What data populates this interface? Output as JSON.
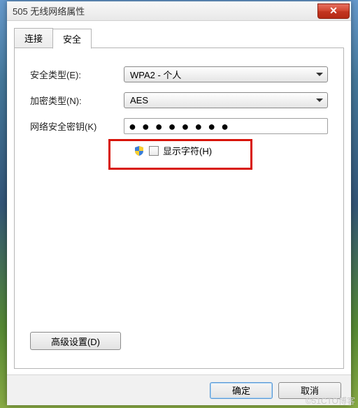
{
  "window": {
    "title": "505 无线网络属性"
  },
  "tabs": {
    "connect": "连接",
    "security": "安全"
  },
  "fields": {
    "securityTypeLabel": "安全类型(E):",
    "securityTypeValue": "WPA2 - 个人",
    "encryptionTypeLabel": "加密类型(N):",
    "encryptionTypeValue": "AES",
    "keyLabel": "网络安全密钥(K)",
    "keyMask": "●●●●●●●●",
    "showCharsLabel": "显示字符(H)"
  },
  "buttons": {
    "advanced": "高级设置(D)",
    "ok": "确定",
    "cancel": "取消"
  },
  "watermark": "©51CTO博客"
}
